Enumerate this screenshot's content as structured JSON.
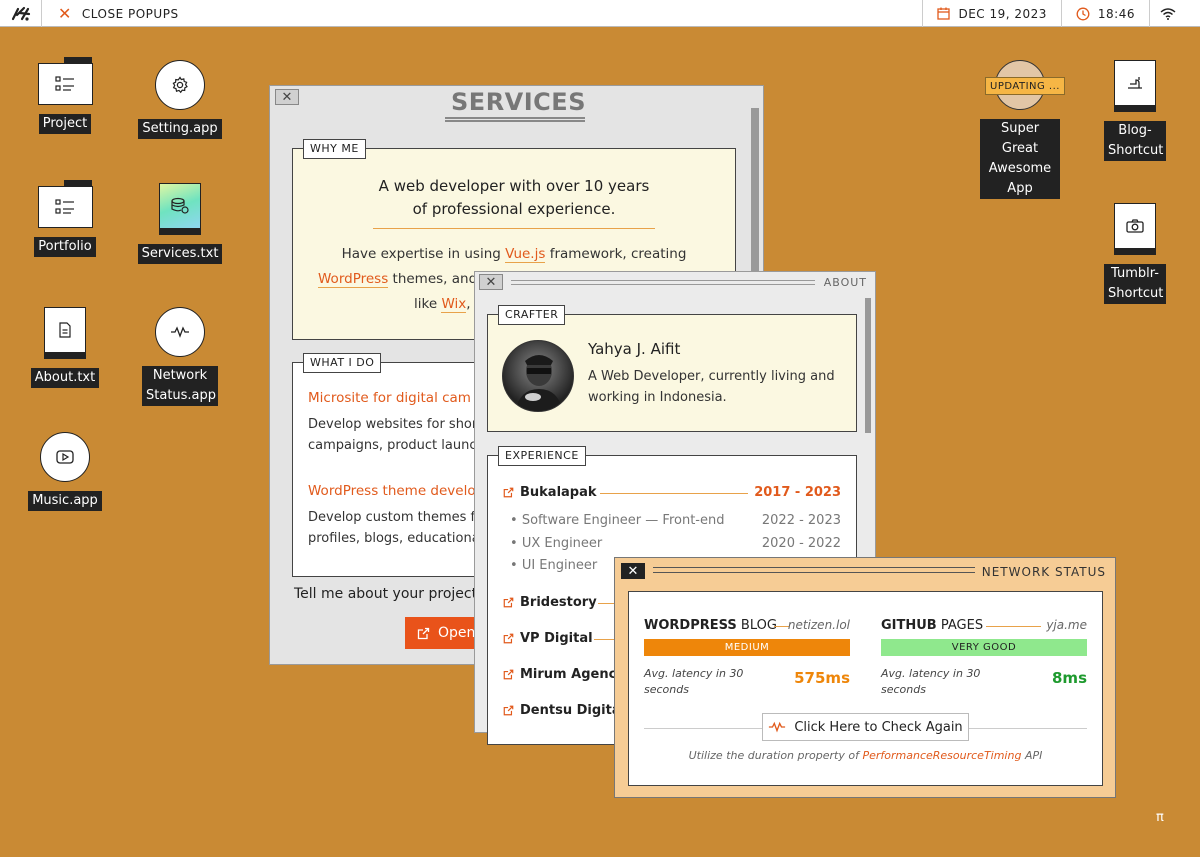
{
  "topbar": {
    "close_popups": "CLOSE POPUPS",
    "date": "DEC 19, 2023",
    "time": "18:46"
  },
  "desktop_icons": {
    "project": "Project",
    "setting": "Setting.app",
    "portfolio": "Portfolio",
    "services": "Services.txt",
    "about": "About.txt",
    "network": "Network Status.app",
    "music": "Music.app",
    "super_app": "Super Great Awesome App",
    "super_app_badge": "UPDATING ...",
    "blog": "Blog-Shortcut",
    "tumblr": "Tumblr-Shortcut"
  },
  "services": {
    "title": "SERVICES",
    "why_me_tag": "WHY ME",
    "why_me_heading_1": "A web developer with over 10 years",
    "why_me_heading_2": "of professional experience.",
    "why_me_body_1": "Have expertise in using",
    "why_me_link_vue": "Vue.js",
    "why_me_body_2": "framework, creating",
    "why_me_link_wp": "WordPress",
    "why_me_body_3": "themes, and",
    "why_me_body_4": "like",
    "why_me_link_wix": "Wix",
    "why_me_body_5": ",",
    "what_i_do_tag": "WHAT I DO",
    "item1_title": "Microsite for digital cam",
    "item1_desc_1": "Develop websites for shor",
    "item1_desc_2": "campaigns, product launc",
    "item2_title": "WordPress theme develo",
    "item2_desc_1": "Develop custom themes fo",
    "item2_desc_2": "profiles, blogs, educationa",
    "cta": "Tell me about your project",
    "button": "Open"
  },
  "about": {
    "title": "ABOUT",
    "crafter_tag": "CRAFTER",
    "name": "Yahya J. Aifit",
    "role": "A Web Developer, currently living and working in Indonesia.",
    "experience_tag": "EXPERIENCE",
    "companies": [
      {
        "name": "Bukalapak",
        "years": "2017 - 2023"
      },
      {
        "name": "Bridestory",
        "years": ""
      },
      {
        "name": "VP Digital",
        "years": ""
      },
      {
        "name": "Mirum Agency",
        "years": ""
      },
      {
        "name": "Dentsu Digital",
        "years": ""
      }
    ],
    "jobs": [
      {
        "title": "Software Engineer — Front-end",
        "years": "2022 - 2023"
      },
      {
        "title": "UX Engineer",
        "years": "2020 - 2022"
      },
      {
        "title": "UI Engineer",
        "years": ""
      }
    ]
  },
  "network": {
    "title": "NETWORK STATUS",
    "wp_name_bold": "WORDPRESS",
    "wp_name_rest": " BLOG",
    "wp_domain": "netizen.lol",
    "wp_status": "MEDIUM",
    "wp_latency_label": "Avg. latency in 30 seconds",
    "wp_latency": "575ms",
    "gh_name_bold": "GITHUB",
    "gh_name_rest": " PAGES",
    "gh_domain": "yja.me",
    "gh_status": "VERY GOOD",
    "gh_latency_label": "Avg. latency in 30 seconds",
    "gh_latency": "8ms",
    "check_button": "Click Here to Check Again",
    "note_1": "Utilize the duration property of",
    "note_link": "PerformanceResourceTiming",
    "note_2": "API"
  },
  "footer_glyph": "π",
  "colors": {
    "desktop": "#c98a34",
    "accent": "#e15a1c",
    "medium": "#ee860a",
    "good": "#8fe88d"
  }
}
